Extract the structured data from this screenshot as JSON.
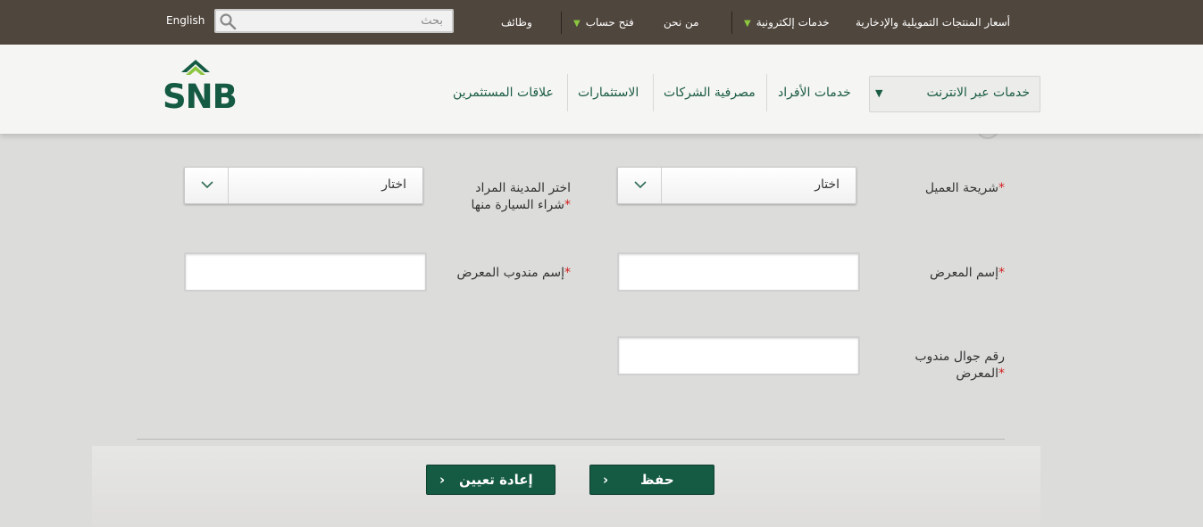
{
  "topbar": {
    "language": "English",
    "search_placeholder": "بحث",
    "nav": {
      "prices": "أسعار المنتجات التمويلية والإدخارية",
      "eservices": "خدمات إلكترونية",
      "about": "من نحن",
      "open_account": "فتح حساب",
      "jobs": "وظائف"
    }
  },
  "header": {
    "logo_text": "SNB",
    "online_services": "خدمات عبر الانترنت",
    "nav": {
      "personal": "خدمات الأفراد",
      "corporate": "مصرفية الشركات",
      "investments": "الاستثمارات",
      "investor_relations": "علاقات المستثمرين"
    }
  },
  "form": {
    "customer_segment": {
      "label": "شريحة العميل",
      "value": "اختار"
    },
    "city": {
      "label_line1": "اختر المدينة المراد",
      "label_line2": "شراء السيارة منها",
      "value": "اختار"
    },
    "showroom_name": {
      "label": "إسم المعرض"
    },
    "showroom_rep_name": {
      "label": "إسم مندوب المعرض"
    },
    "rep_mobile": {
      "label_line1": "رقم جوال مندوب",
      "label_line2": "المعرض"
    },
    "required_mark": "*"
  },
  "buttons": {
    "save": "حفظ",
    "reset": "إعادة تعيين"
  },
  "colors": {
    "topbar": "#4f463d",
    "brand_green": "#155a43",
    "accent_green": "#8cc63f",
    "required": "#d21f1f"
  }
}
